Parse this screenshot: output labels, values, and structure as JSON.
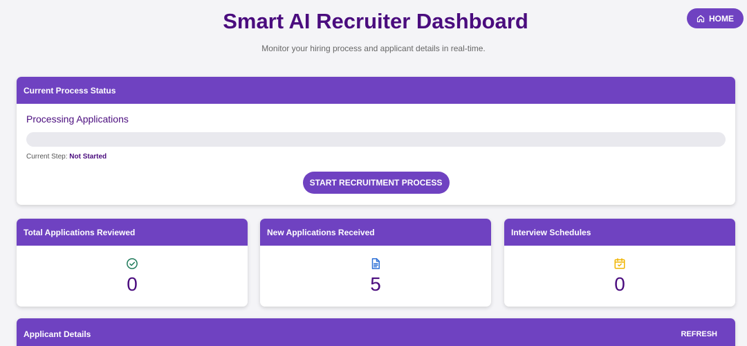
{
  "header": {
    "title": "Smart AI Recruiter Dashboard",
    "subtitle": "Monitor your hiring process and applicant details in real-time.",
    "home_label": "HOME"
  },
  "process": {
    "card_title": "Current Process Status",
    "status_title": "Processing Applications",
    "progress_percent": 0,
    "step_label": "Current Step:",
    "step_value": "Not Started",
    "start_button_label": "START RECRUITMENT PROCESS"
  },
  "stats": [
    {
      "title": "Total Applications Reviewed",
      "value": "0",
      "icon": "check-circle-icon",
      "icon_color": "#1e7a5a"
    },
    {
      "title": "New Applications Received",
      "value": "5",
      "icon": "document-icon",
      "icon_color": "#2b6fd6"
    },
    {
      "title": "Interview Schedules",
      "value": "0",
      "icon": "calendar-check-icon",
      "icon_color": "#f0b400"
    }
  ],
  "applicants": {
    "title": "Applicant Details",
    "refresh_label": "REFRESH"
  },
  "colors": {
    "accent": "#6f42c1",
    "title": "#4a0c7e",
    "background": "#f4f4f7"
  }
}
